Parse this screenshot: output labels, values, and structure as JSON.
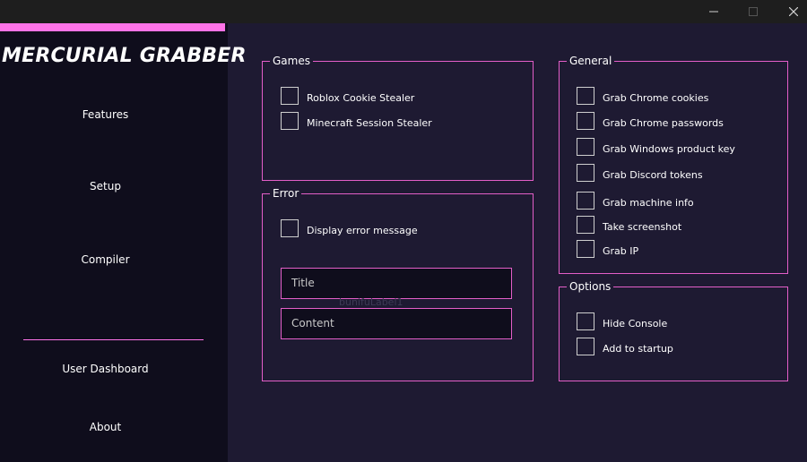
{
  "window": {
    "minimize_glyph": "—",
    "close_glyph": "✕"
  },
  "sidebar": {
    "logo": "MERCURIAL GRABBER",
    "nav": [
      "Features",
      "Setup",
      "Compiler",
      "User Dashboard",
      "About"
    ]
  },
  "games": {
    "title": "Games",
    "options": [
      "Roblox Cookie Stealer",
      "Minecraft Session Stealer"
    ]
  },
  "error": {
    "title": "Error",
    "option": "Display error message",
    "title_field_placeholder": "Title",
    "content_field_placeholder": "Content",
    "ghost_label": "bunifuLabel1"
  },
  "general": {
    "title": "General",
    "options": [
      "Grab Chrome cookies",
      "Grab Chrome passwords",
      "Grab Windows product key",
      "Grab Discord tokens",
      "Grab machine info",
      "Take screenshot",
      "Grab IP"
    ]
  },
  "options": {
    "title": "Options",
    "items": [
      "Hide Console",
      "Add to startup"
    ]
  },
  "colors": {
    "accent": "#ff73e8",
    "border": "#e35ec8",
    "sidebar_bg": "#0f0d1c",
    "main_bg": "#1e1a32"
  }
}
